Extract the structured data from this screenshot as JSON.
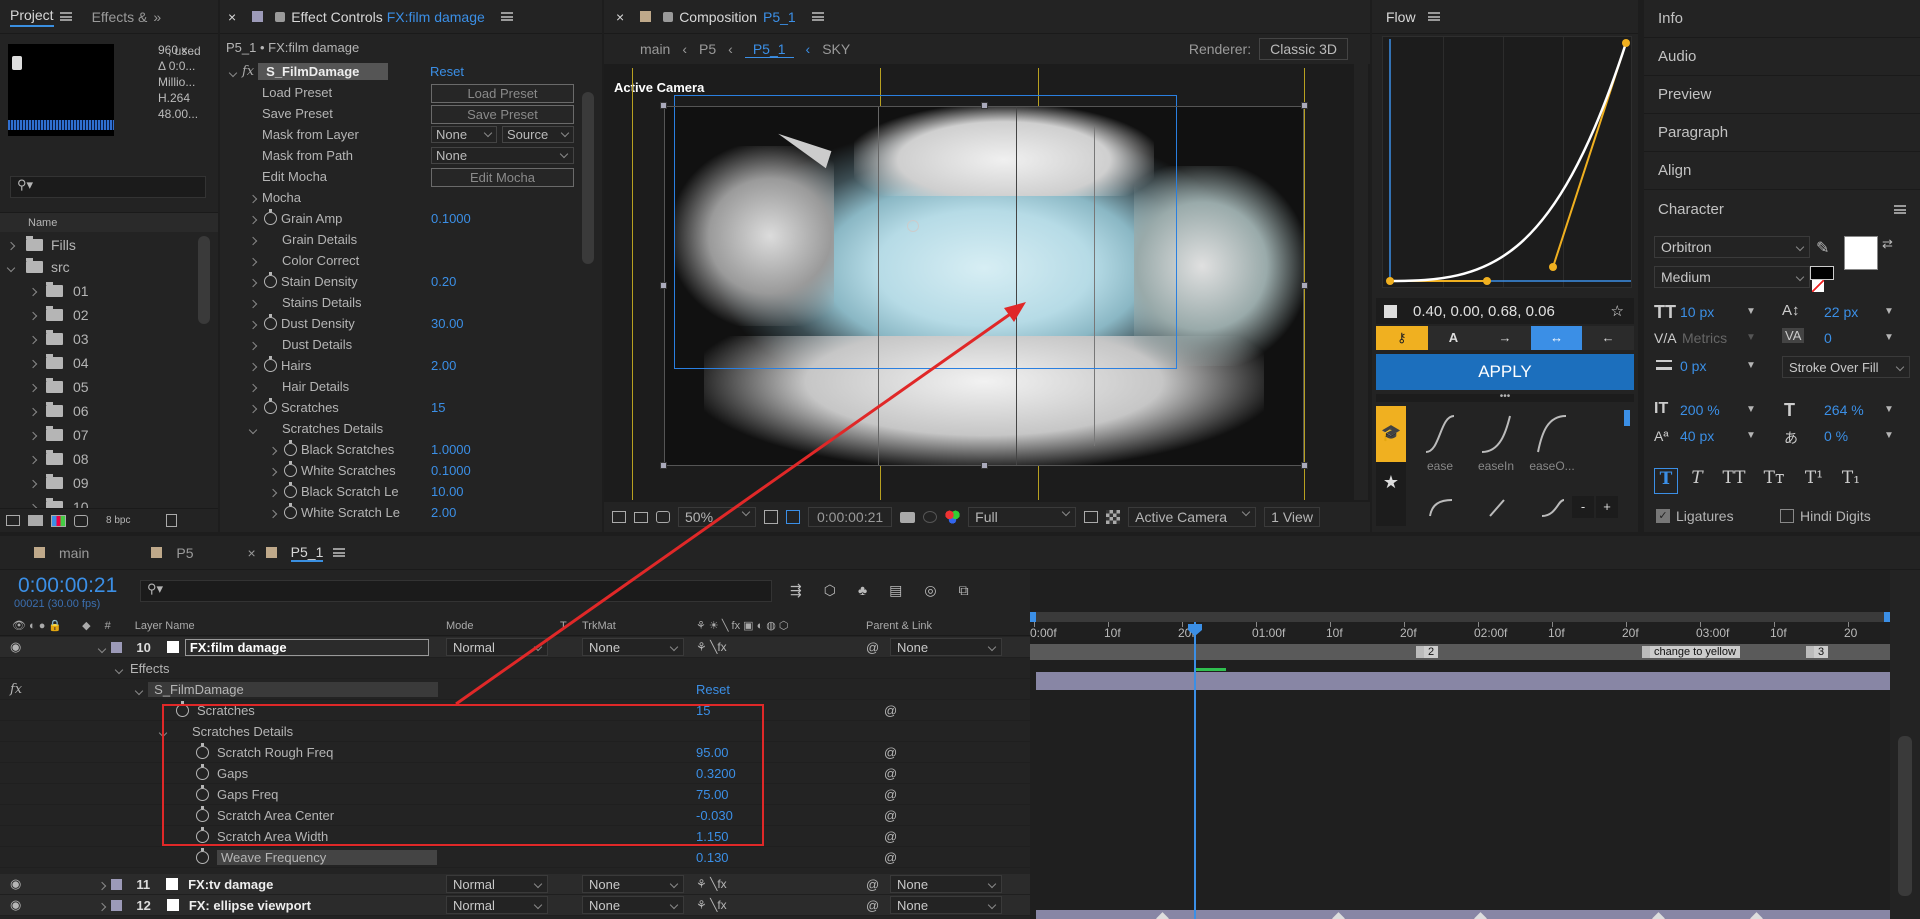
{
  "project_panel": {
    "tabs": [
      "Project",
      "Effects &"
    ],
    "info_lines": [
      "960 x...",
      "Δ 0:0...",
      "Millio...",
      "H.264",
      "48.00..."
    ],
    "used_label": ", used",
    "column_name": "Name",
    "items": [
      "Fills",
      "src",
      "01",
      "02",
      "03",
      "04",
      "05",
      "06",
      "07",
      "08",
      "09",
      "10"
    ],
    "bpc": "8 bpc"
  },
  "effect_controls": {
    "tab_title": "Effect Controls",
    "tab_layer": "FX:film damage",
    "breadcrumb": "P5_1 • FX:film damage",
    "effect_name": "S_FilmDamage",
    "reset": "Reset",
    "rows": [
      {
        "label": "Load Preset",
        "button": "Load Preset"
      },
      {
        "label": "Save Preset",
        "button": "Save Preset"
      },
      {
        "label": "Mask from Layer",
        "sel1": "None",
        "sel2": "Source"
      },
      {
        "label": "Mask from Path",
        "sel1": "None"
      },
      {
        "label": "Edit Mocha",
        "button": "Edit Mocha"
      },
      {
        "label": "Mocha"
      },
      {
        "label": "Grain Amp",
        "value": "0.1000"
      },
      {
        "label": "Grain Details"
      },
      {
        "label": "Color Correct"
      },
      {
        "label": "Stain Density",
        "value": "0.20"
      },
      {
        "label": "Stains Details"
      },
      {
        "label": "Dust Density",
        "value": "30.00"
      },
      {
        "label": "Dust Details"
      },
      {
        "label": "Hairs",
        "value": "2.00"
      },
      {
        "label": "Hair Details"
      },
      {
        "label": "Scratches",
        "value": "15"
      },
      {
        "label": "Scratches Details"
      },
      {
        "label": "Black Scratches",
        "value": "1.0000"
      },
      {
        "label": "White Scratches",
        "value": "0.1000"
      },
      {
        "label": "Black Scratch Le",
        "value": "10.00"
      },
      {
        "label": "White Scratch Le",
        "value": "2.00"
      }
    ]
  },
  "composition": {
    "tab_title": "Composition",
    "tab_name": "P5_1",
    "crumbs": [
      "main",
      "P5",
      "P5_1",
      "SKY"
    ],
    "renderer_label": "Renderer:",
    "renderer": "Classic 3D",
    "view_label": "Active Camera",
    "zoom": "50%",
    "timecode": "0:00:00:21",
    "resolution": "Full",
    "camera": "Active Camera",
    "views": "1 View"
  },
  "flow": {
    "title": "Flow",
    "values": "0.40, 0.00, 0.68, 0.06",
    "apply": "APPLY",
    "presets": [
      "ease",
      "easeIn",
      "easeO..."
    ],
    "minus": "-",
    "plus": "+"
  },
  "right_panel": {
    "items": [
      "Info",
      "Audio",
      "Preview",
      "Paragraph",
      "Align"
    ],
    "character_title": "Character",
    "font": "Orbitron",
    "style": "Medium",
    "size": "10 px",
    "leading": "22 px",
    "kerning": "Metrics",
    "tracking": "0",
    "stroke": "0 px",
    "stroke_mode": "Stroke Over Fill",
    "vscale": "200 %",
    "hscale": "264 %",
    "baseline": "40 px",
    "tsume": "0 %",
    "ligatures": "Ligatures",
    "hindi": "Hindi Digits",
    "type_buttons": [
      "T",
      "T",
      "TT",
      "Tт",
      "T¹",
      "T₁"
    ]
  },
  "timeline": {
    "tabs": [
      "main",
      "P5",
      "P5_1"
    ],
    "timecode": "0:00:00:21",
    "frames": "00021 (30.00 fps)",
    "col_layer": "Layer Name",
    "col_mode": "Mode",
    "col_t": "T",
    "col_trkmat": "TrkMat",
    "col_parent": "Parent & Link",
    "ruler": [
      "0:00f",
      "10f",
      "20f",
      "01:00f",
      "10f",
      "20f",
      "02:00f",
      "10f",
      "20f",
      "03:00f",
      "10f",
      "20"
    ],
    "markers": [
      {
        "label": "2"
      },
      {
        "label": "change to yellow"
      },
      {
        "label": "3"
      }
    ],
    "layer10": {
      "num": "10",
      "name": "FX:film damage",
      "mode": "Normal",
      "trkmat": "None",
      "parent": "None"
    },
    "effects_label": "Effects",
    "effect_name": "S_FilmDamage",
    "effect_reset": "Reset",
    "props": [
      {
        "label": "Scratches",
        "value": "15"
      },
      {
        "label": "Scratches Details",
        "value": ""
      },
      {
        "label": "Scratch Rough Freq",
        "value": "95.00"
      },
      {
        "label": "Gaps",
        "value": "0.3200"
      },
      {
        "label": "Gaps Freq",
        "value": "75.00"
      },
      {
        "label": "Scratch Area Center",
        "value": "-0.030"
      },
      {
        "label": "Scratch Area Width",
        "value": "1.150"
      },
      {
        "label": "Weave Frequency",
        "value": "0.130"
      }
    ],
    "layer11": {
      "num": "11",
      "name": "FX:tv damage",
      "mode": "Normal",
      "trkmat": "None",
      "parent": "None"
    },
    "layer12": {
      "num": "12",
      "name": "FX: ellipse viewport",
      "mode": "Normal",
      "trkmat": "None",
      "parent": "None"
    }
  }
}
